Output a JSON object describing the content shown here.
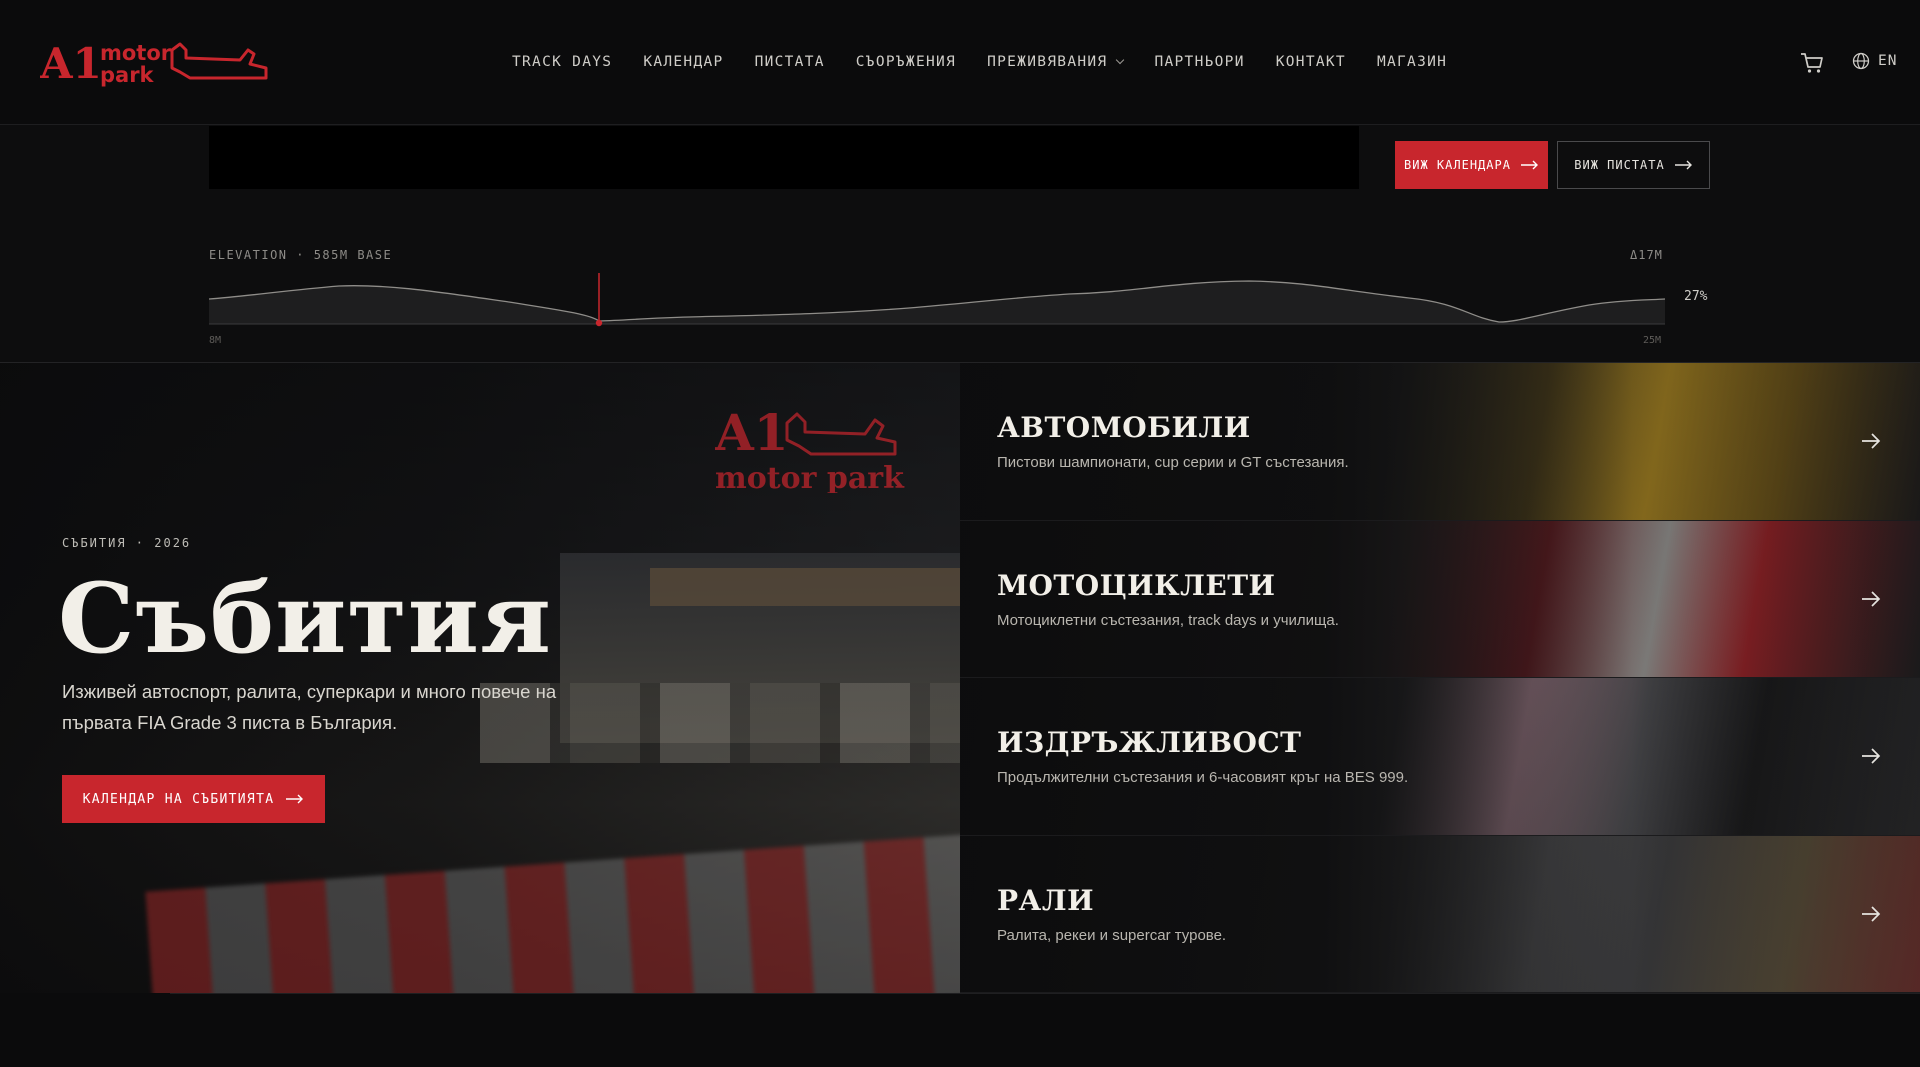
{
  "brand": {
    "logo_mark": "A1",
    "logo_line1": "motor",
    "logo_line2": "park",
    "accent": "#c8262d"
  },
  "nav": {
    "items": [
      {
        "label": "TRACK DAYS"
      },
      {
        "label": "КАЛЕНДАР"
      },
      {
        "label": "ПИСТАТА"
      },
      {
        "label": "СЪОРЪЖЕНИЯ"
      },
      {
        "label": "ПРЕЖИВЯВАНИЯ",
        "has_dropdown": true
      },
      {
        "label": "ПАРТНЬОРИ"
      },
      {
        "label": "КОНТАКТ"
      },
      {
        "label": "МАГАЗИН"
      }
    ],
    "cart_icon": "cart-icon",
    "language_icon": "globe-icon",
    "language": "EN"
  },
  "strip": {
    "btn_calendar": "ВИЖ КАЛЕНДАРА",
    "btn_track": "ВИЖ ПИСТАТА",
    "elevation_label": "ELEVATION · 585M BASE",
    "elevation_delta": "Δ17M",
    "elevation_percent": "27%",
    "tick_min": "8M",
    "tick_max": "25M",
    "marker_fraction": 0.27
  },
  "hero": {
    "kicker": "СЪБИТИЯ · 2026",
    "title": "Събития",
    "description": "Изживей автоспорт, ралита, суперкари и много повече на първата FIA Grade 3 писта в България.",
    "button": "КАЛЕНДАР НА СЪБИТИЯТА",
    "bg_logo_mark": "A1",
    "bg_logo_text": "motor park"
  },
  "categories": [
    {
      "title": "АВТОМОБИЛИ",
      "subtitle": "Пистови шампионати, cup серии и GT състезания."
    },
    {
      "title": "МОТОЦИКЛЕТИ",
      "subtitle": "Мотоциклетни състезания, track days и училища."
    },
    {
      "title": "ИЗДРЪЖЛИВОСТ",
      "subtitle": "Продължителни състезания и 6-часовият кръг на BES 999."
    },
    {
      "title": "РАЛИ",
      "subtitle": "Ралита, рекеи и supercar турове."
    }
  ]
}
